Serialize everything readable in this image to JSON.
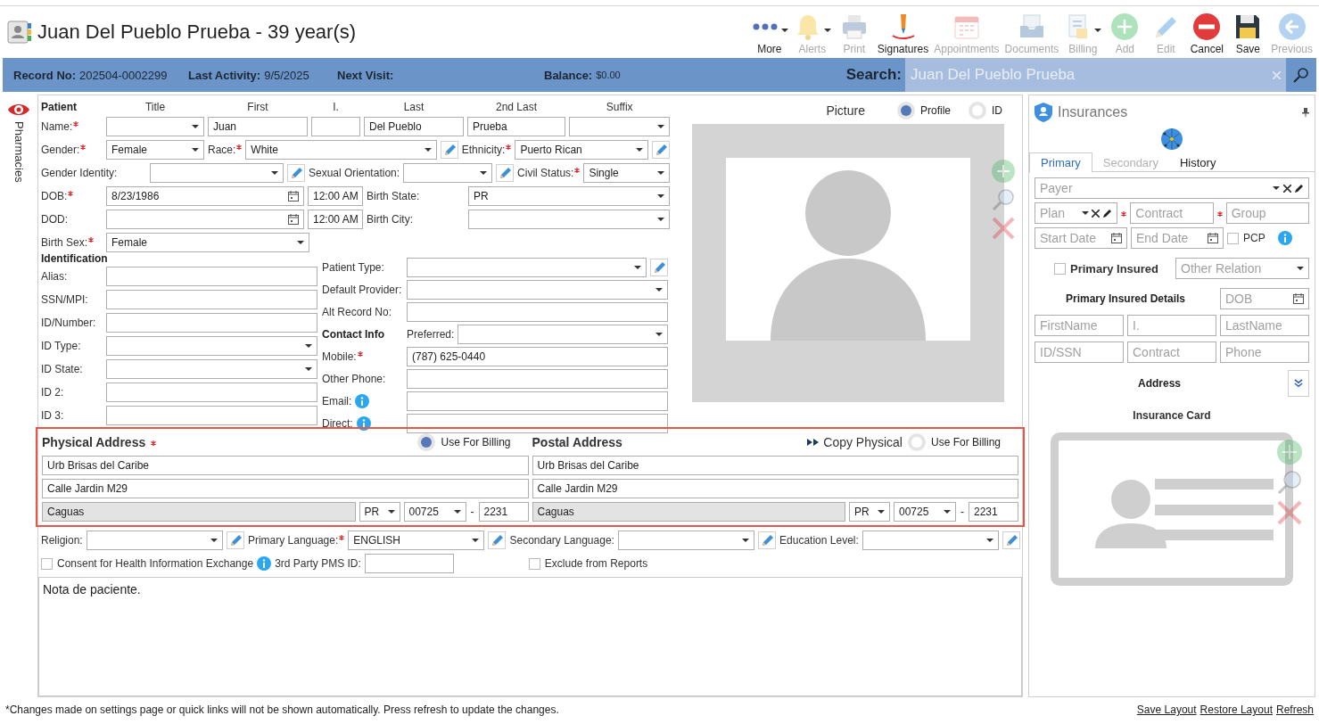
{
  "header": {
    "title": "Juan Del Pueblo Prueba - 39 year(s)",
    "toolbar": [
      {
        "label": "More",
        "kind": "more",
        "disabled": false,
        "menu": true
      },
      {
        "label": "Alerts",
        "kind": "bell",
        "disabled": true,
        "menu": true
      },
      {
        "label": "Print",
        "kind": "printer",
        "disabled": true,
        "menu": false
      },
      {
        "label": "Signatures",
        "kind": "signature",
        "disabled": false,
        "menu": false
      },
      {
        "label": "Appointments",
        "kind": "calendar",
        "disabled": true,
        "menu": false
      },
      {
        "label": "Documents",
        "kind": "tray",
        "disabled": true,
        "menu": false
      },
      {
        "label": "Billing",
        "kind": "billing",
        "disabled": true,
        "menu": true
      },
      {
        "label": "Add",
        "kind": "add",
        "disabled": true,
        "menu": false
      },
      {
        "label": "Edit",
        "kind": "edit",
        "disabled": true,
        "menu": false
      },
      {
        "label": "Cancel",
        "kind": "cancel",
        "disabled": false,
        "menu": false
      },
      {
        "label": "Save",
        "kind": "save",
        "disabled": false,
        "menu": false
      },
      {
        "label": "Previous",
        "kind": "previous",
        "disabled": true,
        "menu": false
      }
    ]
  },
  "info_bar": {
    "fields": [
      {
        "label": "Record No:",
        "value": "202504-0002299"
      },
      {
        "label": "Last Activity:",
        "value": "9/5/2025"
      },
      {
        "label": "Next Visit:"
      },
      {
        "label": "Balance:",
        "value": "$0.00"
      }
    ],
    "search": {
      "label": "Search:",
      "value": "Juan Del Pueblo Prueba"
    }
  },
  "side_tabs": [
    {
      "label": "Pharmacies"
    }
  ],
  "patient": {
    "headings": [
      "Patient",
      "Title",
      "First",
      "I.",
      "Last",
      "2nd Last",
      "Suffix"
    ],
    "name_row": [
      {
        "kind": "label",
        "text": "Name:",
        "required": true
      },
      {
        "kind": "select"
      },
      {
        "kind": "input",
        "value": "Juan"
      },
      {
        "kind": "input"
      },
      {
        "kind": "input",
        "value": "Del Pueblo"
      },
      {
        "kind": "input",
        "value": "Prueba"
      },
      {
        "kind": "select"
      }
    ],
    "rows": [
      [
        {
          "kind": "label",
          "text": "Gender:",
          "required": true
        },
        {
          "kind": "select",
          "value": "Female"
        },
        {
          "kind": "label",
          "text": "Race:",
          "required": true
        },
        {
          "kind": "select",
          "value": "White"
        },
        {
          "kind": "pencil"
        },
        {
          "kind": "label",
          "text": "Ethnicity:",
          "required": true
        },
        {
          "kind": "select",
          "value": "Puerto Rican"
        },
        {
          "kind": "pencil"
        }
      ],
      [
        {
          "kind": "label",
          "text": "Gender Identity:",
          "required": false
        },
        {
          "kind": "select"
        },
        {
          "kind": "pencil"
        },
        {
          "kind": "label",
          "text": "Sexual Orientation:",
          "required": false
        },
        {
          "kind": "select"
        },
        {
          "kind": "pencil"
        },
        {
          "kind": "label",
          "text": "Civil Status:",
          "required": true
        },
        {
          "kind": "select",
          "value": "Single"
        }
      ],
      [
        {
          "kind": "label",
          "text": "DOB:",
          "required": true
        },
        {
          "kind": "date",
          "value": "8/23/1986"
        },
        {
          "kind": "input",
          "value": "12:00 AM"
        },
        {
          "kind": "label",
          "text": "Birth State:",
          "required": false
        },
        {
          "kind": "select",
          "value": "PR"
        }
      ],
      [
        {
          "kind": "label",
          "text": "DOD:",
          "required": false
        },
        {
          "kind": "date"
        },
        {
          "kind": "input",
          "value": "12:00 AM"
        },
        {
          "kind": "label",
          "text": "Birth City:",
          "required": false
        },
        {
          "kind": "select"
        }
      ],
      [
        {
          "kind": "label",
          "text": "Birth Sex:",
          "required": true
        },
        {
          "kind": "select",
          "value": "Female"
        }
      ]
    ]
  },
  "identification": {
    "title": "Identification",
    "rows": [
      [
        {
          "kind": "label",
          "text": "Alias:",
          "required": false
        },
        {
          "kind": "input"
        }
      ],
      [
        {
          "kind": "label",
          "text": "SSN/MPI:",
          "required": false
        },
        {
          "kind": "input"
        }
      ],
      [
        {
          "kind": "label",
          "text": "ID/Number:",
          "required": false
        },
        {
          "kind": "input"
        }
      ],
      [
        {
          "kind": "label",
          "text": "ID Type:",
          "required": false
        },
        {
          "kind": "select"
        }
      ],
      [
        {
          "kind": "label",
          "text": "ID State:",
          "required": false
        },
        {
          "kind": "select"
        }
      ],
      [
        {
          "kind": "label",
          "text": "ID 2:",
          "required": false
        },
        {
          "kind": "input"
        }
      ],
      [
        {
          "kind": "label",
          "text": "ID 3:",
          "required": false
        },
        {
          "kind": "input"
        }
      ]
    ]
  },
  "contact_rows": [
    [
      {
        "kind": "label",
        "text": "Patient Type:",
        "required": false
      },
      {
        "kind": "select"
      },
      {
        "kind": "pencil"
      }
    ],
    [
      {
        "kind": "label",
        "text": "Default Provider:",
        "required": false
      },
      {
        "kind": "select"
      }
    ],
    [
      {
        "kind": "label",
        "text": "Alt Record No:",
        "required": false
      },
      {
        "kind": "input"
      }
    ],
    [
      {
        "kind": "heading",
        "text": "Contact Info"
      },
      {
        "kind": "label",
        "text": "Preferred:",
        "required": false
      },
      {
        "kind": "select"
      }
    ],
    [
      {
        "kind": "label",
        "text": "Mobile:",
        "required": true
      },
      {
        "kind": "input",
        "value": "(787) 625-0440"
      }
    ],
    [
      {
        "kind": "label",
        "text": "Other Phone:",
        "required": false
      },
      {
        "kind": "input"
      }
    ],
    [
      {
        "kind": "label",
        "text": "Email:",
        "required": false
      },
      {
        "kind": "info"
      },
      {
        "kind": "input"
      }
    ],
    [
      {
        "kind": "label",
        "text": "Direct:",
        "required": false
      },
      {
        "kind": "info"
      },
      {
        "kind": "input"
      }
    ]
  ],
  "picture": {
    "label": "Picture",
    "options": [
      {
        "label": "Profile",
        "selected": true
      },
      {
        "label": "ID",
        "selected": false
      }
    ]
  },
  "addresses": [
    {
      "title": "Physical Address",
      "required": true,
      "use_for_billing": {
        "label": "Use For Billing",
        "selected": true
      },
      "line1": "Urb Brisas del Caribe",
      "line2": "Calle Jardin M29",
      "city": {
        "value": "Caguas",
        "disabled": true
      },
      "state": "PR",
      "zip": "00725",
      "zip_separator": "-",
      "zip4": "2231"
    },
    {
      "title": "Postal Address",
      "required": false,
      "copy_button": "Copy Physical",
      "use_for_billing": {
        "label": "Use For Billing",
        "selected": false
      },
      "line1": "Urb Brisas del Caribe",
      "line2": "Calle Jardin M29",
      "city": {
        "value": "Caguas",
        "disabled": true
      },
      "state": "PR",
      "zip": "00725",
      "zip_separator": "-",
      "zip4": "2231"
    }
  ],
  "extra_rows": [
    [
      {
        "kind": "label",
        "text": "Religion:",
        "required": false
      },
      {
        "kind": "select"
      },
      {
        "kind": "pencil"
      },
      {
        "kind": "label",
        "text": "Primary Language:",
        "required": true
      },
      {
        "kind": "select",
        "value": "ENGLISH"
      },
      {
        "kind": "pencil"
      },
      {
        "kind": "label",
        "text": "Secondary Language:",
        "required": false
      },
      {
        "kind": "select"
      },
      {
        "kind": "pencil"
      },
      {
        "kind": "label",
        "text": "Education Level:",
        "required": false
      },
      {
        "kind": "select"
      },
      {
        "kind": "pencil"
      }
    ],
    [
      {
        "kind": "checkbox",
        "text": "Consent for Health Information Exchange",
        "checked": false
      },
      {
        "kind": "info"
      },
      {
        "kind": "label",
        "text": "3rd Party PMS ID:",
        "required": false
      },
      {
        "kind": "input"
      },
      {
        "kind": "checkbox",
        "text": "Exclude from Reports",
        "checked": false
      }
    ]
  ],
  "notes": "Nota de paciente.",
  "insurance": {
    "title": "Insurances",
    "tabs": [
      {
        "label": "Primary",
        "selected": true,
        "disabled": false
      },
      {
        "label": "Secondary",
        "selected": false,
        "disabled": true
      },
      {
        "label": "History",
        "selected": false,
        "disabled": false
      }
    ],
    "payer": {
      "placeholder": "Payer"
    },
    "plan": {
      "placeholder": "Plan"
    },
    "contract": {
      "placeholder": "Contract",
      "required": true
    },
    "group": {
      "placeholder": "Group",
      "required": true
    },
    "start_date": {
      "placeholder": "Start Date"
    },
    "end_date": {
      "placeholder": "End Date"
    },
    "pcp": {
      "label": "PCP",
      "checked": false
    },
    "primary_insured": {
      "label": "Primary Insured",
      "checked": false
    },
    "other_relation": {
      "placeholder": "Other Relation"
    },
    "details_title": "Primary Insured Details",
    "dob": {
      "placeholder": "DOB"
    },
    "details_fields": [
      {
        "placeholder": "FirstName"
      },
      {
        "placeholder": "I."
      },
      {
        "placeholder": "LastName"
      },
      {
        "placeholder": "ID/SSN"
      },
      {
        "placeholder": "Contract"
      },
      {
        "placeholder": "Phone"
      }
    ],
    "address_label": "Address",
    "card_label": "Insurance Card"
  },
  "footer": {
    "message": "*Changes made on settings page or quick links will not be shown automatically. Press refresh to update the changes.",
    "links": [
      "Save Layout",
      "Restore Layout",
      "Refresh"
    ]
  }
}
